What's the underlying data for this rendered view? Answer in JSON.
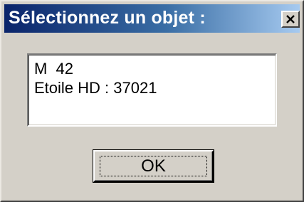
{
  "dialog": {
    "title": "Sélectionnez un objet :",
    "close_icon": "close-icon"
  },
  "list": {
    "items": [
      {
        "label": "M  42"
      },
      {
        "label": "Etoile HD : 37021"
      }
    ]
  },
  "buttons": {
    "ok_label": "OK"
  },
  "colors": {
    "titlebar_start": "#0a246a",
    "titlebar_end": "#a6caf0",
    "face": "#d4d0c8",
    "list_bg": "#ffffff"
  }
}
